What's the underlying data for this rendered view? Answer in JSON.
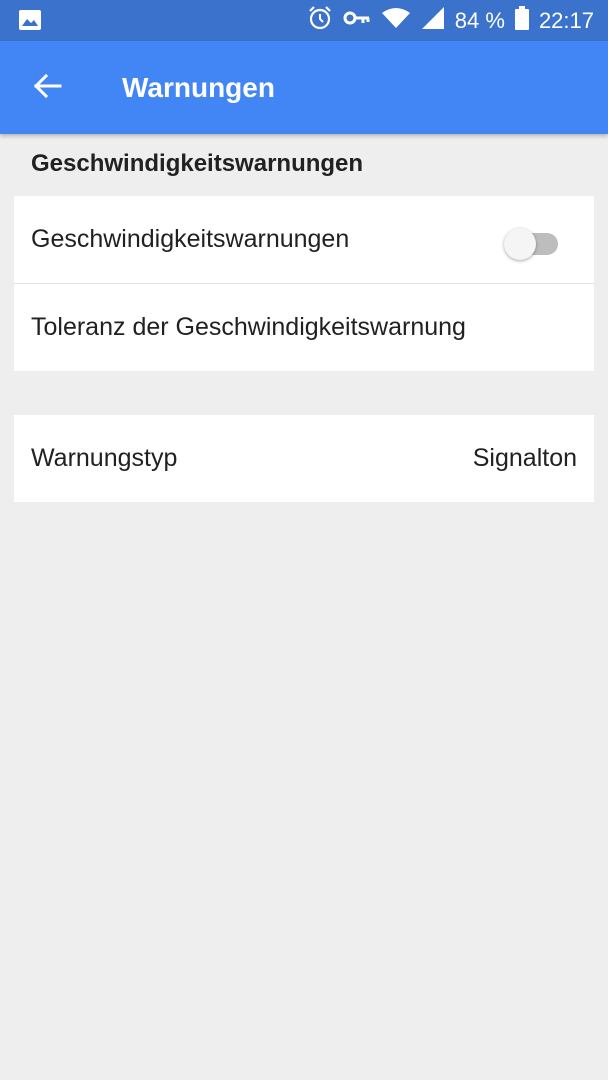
{
  "status_bar": {
    "battery_percent": "84 %",
    "time": "22:17",
    "icons": [
      "image-icon",
      "alarm-icon",
      "vpn-key-icon",
      "wifi-icon",
      "signal-icon",
      "battery-icon"
    ]
  },
  "app_bar": {
    "title": "Warnungen",
    "back_icon": "arrow-back-icon",
    "color": "#4285f4"
  },
  "section": {
    "header": "Geschwindigkeitswarnungen"
  },
  "settings": {
    "speed_warnings": {
      "label": "Geschwindigkeitswarnungen",
      "enabled": false
    },
    "tolerance": {
      "label": "Toleranz der Geschwindigkeitswarnung"
    },
    "warning_type": {
      "label": "Warnungstyp",
      "value": "Signalton"
    }
  }
}
